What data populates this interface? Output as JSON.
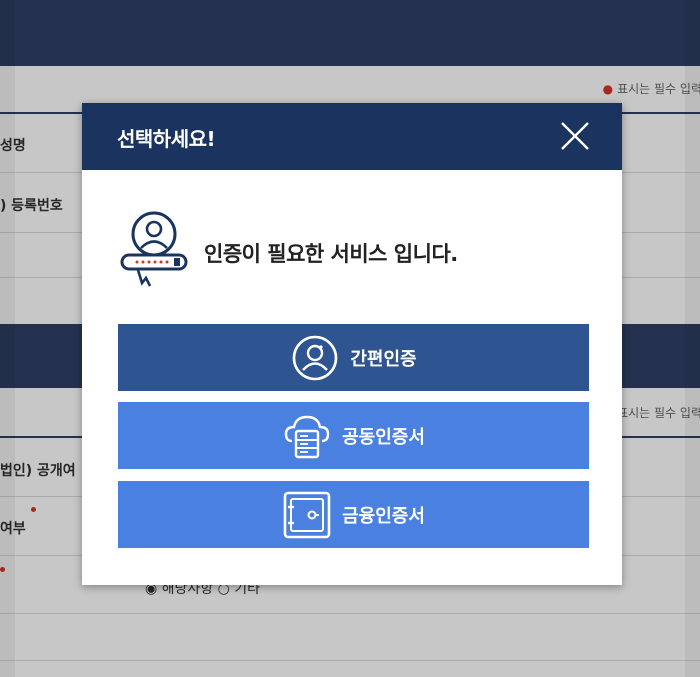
{
  "background": {
    "required_notice": "표시는 필수 입력",
    "labels": [
      "성명",
      ") 등록번호",
      "법인) 공개여",
      "여부"
    ],
    "radio_text": "◉ 해당사항  ○ 기타"
  },
  "modal": {
    "title": "선택하세요!",
    "close_icon": "close-icon",
    "intro_text": "인증이 필요한 서비스 입니다.",
    "intro_icon": "user-certificate-icon",
    "options": [
      {
        "label": "간편인증",
        "icon": "user-circle-icon",
        "color": "#2e5591"
      },
      {
        "label": "공동인증서",
        "icon": "cloud-server-icon",
        "color": "#4a81e0"
      },
      {
        "label": "금융인증서",
        "icon": "safe-icon",
        "color": "#4a81e0"
      }
    ]
  },
  "colors": {
    "header": "#1b345f",
    "band": "#2f4166",
    "required_dot": "#d9342b"
  }
}
